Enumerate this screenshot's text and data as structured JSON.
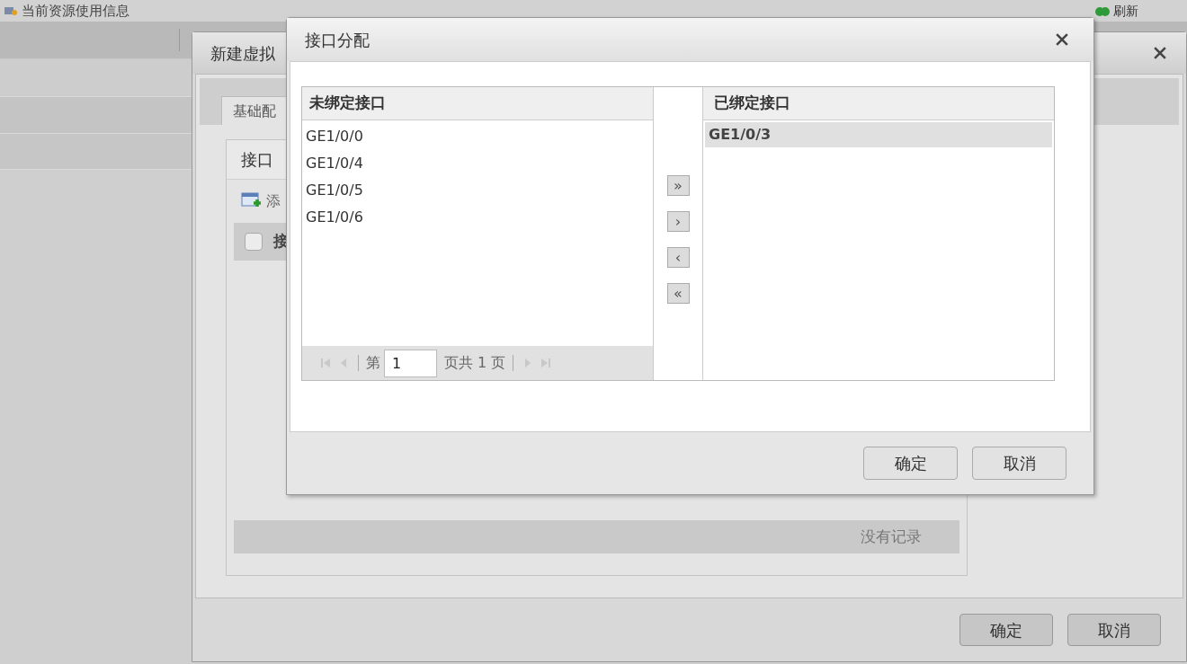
{
  "page": {
    "title": "当前资源使用信息",
    "refresh": "刷新"
  },
  "back_dialog": {
    "title": "新建虚拟",
    "tabs": [
      {
        "label": "基础配",
        "selected": true
      }
    ],
    "panel": {
      "title": "接口",
      "toolbar": [
        "添"
      ],
      "columns": [
        "接"
      ],
      "select_all": {
        "checked": false
      },
      "empty_text": "没有记录"
    },
    "buttons": [
      "确定",
      "取消"
    ]
  },
  "dialog": {
    "title": "接口分配",
    "unbound": {
      "title": "未绑定接口",
      "items": [
        {
          "label": "GE1/0/0",
          "selected": false
        },
        {
          "label": "GE1/0/4",
          "selected": false
        },
        {
          "label": "GE1/0/5",
          "selected": false
        },
        {
          "label": "GE1/0/6",
          "selected": false
        }
      ],
      "pager": {
        "prefix": "第",
        "page": "1",
        "suffix": "页共 1 页"
      }
    },
    "transfer_buttons": [
      "»",
      "›",
      "‹",
      "«"
    ],
    "bound": {
      "title": "已绑定接口",
      "items": [
        {
          "label": "GE1/0/3",
          "selected": true
        }
      ]
    },
    "buttons": [
      "确定",
      "取消"
    ]
  }
}
